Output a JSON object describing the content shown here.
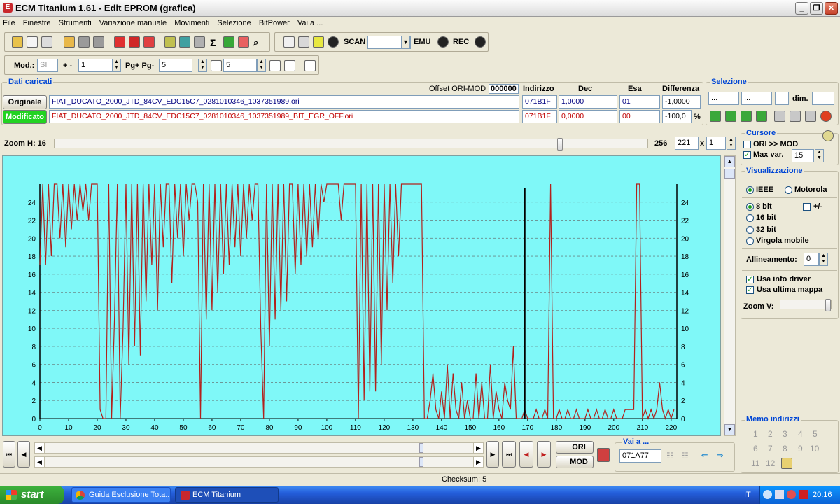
{
  "window": {
    "title": "ECM Titanium 1.61 - Edit EPROM (grafica)"
  },
  "menu": [
    "File",
    "Finestre",
    "Strumenti",
    "Variazione manuale",
    "Movimenti",
    "Selezione",
    "BitPower",
    "Vai a ..."
  ],
  "toolbar1": {
    "scan_label": "SCAN",
    "scan_value": "",
    "emu_label": "EMU",
    "rec_label": "REC"
  },
  "toolbar2": {
    "mod_label": "Mod.:",
    "mod_value": "SI",
    "plusminus_label": "+ -",
    "plusminus_value": "1",
    "pg_label": "Pg+ Pg-",
    "pg_value": "5",
    "p_value": "5"
  },
  "dati": {
    "title": "Dati caricati",
    "offset_label": "Offset ORI-MOD",
    "offset_value": "000000",
    "col_indirizzo": "Indirizzo",
    "col_dec": "Dec",
    "col_esa": "Esa",
    "col_diff": "Differenza",
    "originale": {
      "label": "Originale",
      "file": "FIAT_DUCATO_2000_JTD_84CV_EDC15C7_0281010346_1037351989.ori",
      "indirizzo": "071B1F",
      "dec": "1,0000",
      "esa": "01",
      "diff": "-1,0000"
    },
    "modificato": {
      "label": "Modificato",
      "file": "FIAT_DUCATO_2000_JTD_84CV_EDC15C7_0281010346_1037351989_BIT_EGR_OFF.ori",
      "indirizzo": "071B1F",
      "dec": "0,0000",
      "esa": "00",
      "diff": "-100,0",
      "pct": "%"
    }
  },
  "selezione": {
    "title": "Selezione",
    "from": "...",
    "to": "...",
    "dim_label": "dim."
  },
  "zoom": {
    "label": "Zoom H: 16",
    "max": "256",
    "value": "221",
    "x_label": "x",
    "mult": "1"
  },
  "cursore": {
    "title": "Cursore",
    "ori_mod": "ORI >> MOD",
    "maxvar_label": "Max var.",
    "maxvar_value": "15"
  },
  "visual": {
    "title": "Visualizzazione",
    "ieee": "IEEE",
    "motorola": "Motorola",
    "bit8": "8 bit",
    "pm": "+/-",
    "bit16": "16 bit",
    "bit32": "32 bit",
    "virgola": "Virgola mobile",
    "allineamento_label": "Allineamento:",
    "allineamento_value": "0",
    "info_driver": "Usa info driver",
    "ultima_mappa": "Usa ultima mappa",
    "zoomv_label": "Zoom V:"
  },
  "memo": {
    "title": "Memo indirizzi",
    "items": [
      "1",
      "2",
      "3",
      "4",
      "5",
      "6",
      "7",
      "8",
      "9",
      "10",
      "11",
      "12"
    ]
  },
  "nav": {
    "ori": "ORI",
    "mod": "MOD",
    "vai_title": "Vai a ...",
    "vai_value": "071A77"
  },
  "status": {
    "checksum": "Checksum: 5"
  },
  "taskbar": {
    "start": "start",
    "task1": "Guida Esclusione Tota...",
    "task2": "ECM Titanium",
    "lang": "IT",
    "clock": "20.16"
  },
  "colors": {
    "plot_bg": "#7ff8f8",
    "series": "#b2211c",
    "cursor": "#000000"
  },
  "chart_data": {
    "type": "line",
    "x_ticks": [
      0,
      10,
      20,
      30,
      40,
      50,
      60,
      70,
      80,
      90,
      100,
      110,
      120,
      130,
      140,
      150,
      160,
      170,
      180,
      190,
      200,
      210,
      220
    ],
    "y_ticks": [
      0,
      2,
      4,
      6,
      8,
      10,
      12,
      14,
      16,
      18,
      20,
      22,
      24
    ],
    "xlim": [
      0,
      222
    ],
    "ylim": [
      0,
      26
    ],
    "cursor_x": 169,
    "x": [
      0,
      1,
      2,
      3,
      4,
      5,
      6,
      7,
      8,
      9,
      10,
      11,
      12,
      13,
      14,
      15,
      16,
      17,
      18,
      19,
      20,
      21,
      22,
      23,
      24,
      25,
      26,
      27,
      28,
      29,
      30,
      31,
      32,
      33,
      34,
      35,
      36,
      37,
      38,
      39,
      40,
      41,
      42,
      43,
      44,
      45,
      46,
      47,
      48,
      49,
      50,
      51,
      52,
      53,
      54,
      55,
      56,
      57,
      58,
      59,
      60,
      61,
      62,
      63,
      64,
      65,
      66,
      67,
      68,
      69,
      70,
      71,
      72,
      73,
      74,
      75,
      76,
      77,
      78,
      79,
      80,
      81,
      82,
      83,
      84,
      85,
      86,
      87,
      88,
      89,
      90,
      91,
      92,
      93,
      94,
      95,
      96,
      97,
      98,
      99,
      100,
      101,
      102,
      103,
      104,
      105,
      106,
      107,
      108,
      109,
      110,
      111,
      112,
      113,
      114,
      115,
      116,
      117,
      118,
      119,
      120,
      121,
      122,
      123,
      124,
      125,
      126,
      127,
      128,
      129,
      130,
      131,
      132,
      133,
      134,
      135,
      136,
      137,
      138,
      139,
      140,
      141,
      142,
      143,
      144,
      145,
      146,
      147,
      148,
      149,
      150,
      151,
      152,
      153,
      154,
      155,
      156,
      157,
      158,
      159,
      160,
      161,
      162,
      163,
      164,
      165,
      166,
      167,
      168,
      169,
      170,
      171,
      172,
      173,
      174,
      175,
      176,
      177,
      178,
      179,
      180,
      181,
      182,
      183,
      184,
      185,
      186,
      187,
      188,
      189,
      190,
      191,
      192,
      193,
      194,
      195,
      196,
      197,
      198,
      199,
      200,
      201,
      202,
      203,
      204,
      205,
      206,
      207,
      208,
      209,
      210,
      211,
      212,
      213,
      214,
      215,
      216,
      217,
      218,
      219,
      220,
      221
    ],
    "values": [
      17,
      26,
      17,
      26,
      18,
      26,
      26,
      20,
      26,
      19,
      26,
      21,
      26,
      22,
      26,
      23,
      26,
      22,
      26,
      26,
      26,
      1,
      0,
      0,
      26,
      0,
      11,
      26,
      0,
      10,
      26,
      6,
      26,
      8,
      26,
      7,
      26,
      13,
      26,
      17,
      26,
      12,
      26,
      19,
      26,
      26,
      15,
      26,
      20,
      26,
      18,
      26,
      22,
      26,
      26,
      24,
      0,
      26,
      11,
      26,
      12,
      26,
      14,
      26,
      16,
      26,
      17,
      26,
      19,
      26,
      18,
      26,
      20,
      26,
      22,
      26,
      26,
      10,
      0,
      26,
      8,
      26,
      11,
      26,
      12,
      26,
      13,
      26,
      26,
      16,
      26,
      17,
      26,
      18,
      26,
      19,
      26,
      20,
      26,
      24,
      26,
      26,
      26,
      26,
      26,
      22,
      26,
      26,
      26,
      26,
      26,
      0,
      26,
      2,
      26,
      3,
      26,
      3,
      26,
      6,
      26,
      12,
      26,
      15,
      26,
      18,
      26,
      26,
      26,
      26,
      26,
      26,
      26,
      26,
      0,
      0,
      2,
      5,
      1,
      0,
      3,
      0,
      6,
      0,
      5,
      1,
      0,
      4,
      0,
      2,
      0,
      0,
      5,
      0,
      4,
      0,
      0,
      6,
      0,
      3,
      1,
      0,
      4,
      2,
      1,
      8,
      0,
      0,
      0,
      1,
      0,
      0,
      0,
      1,
      0,
      0,
      1,
      0,
      26,
      0,
      0,
      1,
      0,
      0,
      1,
      0,
      0,
      1,
      0,
      0,
      0,
      1,
      0,
      0,
      1,
      0,
      0,
      1,
      0,
      0,
      1,
      0,
      0,
      0,
      1,
      1,
      1,
      1,
      26,
      26,
      0,
      1,
      0,
      1,
      0,
      1,
      4,
      1,
      0,
      1,
      0,
      1,
      2,
      1,
      0,
      2,
      1,
      0,
      2,
      1
    ]
  }
}
